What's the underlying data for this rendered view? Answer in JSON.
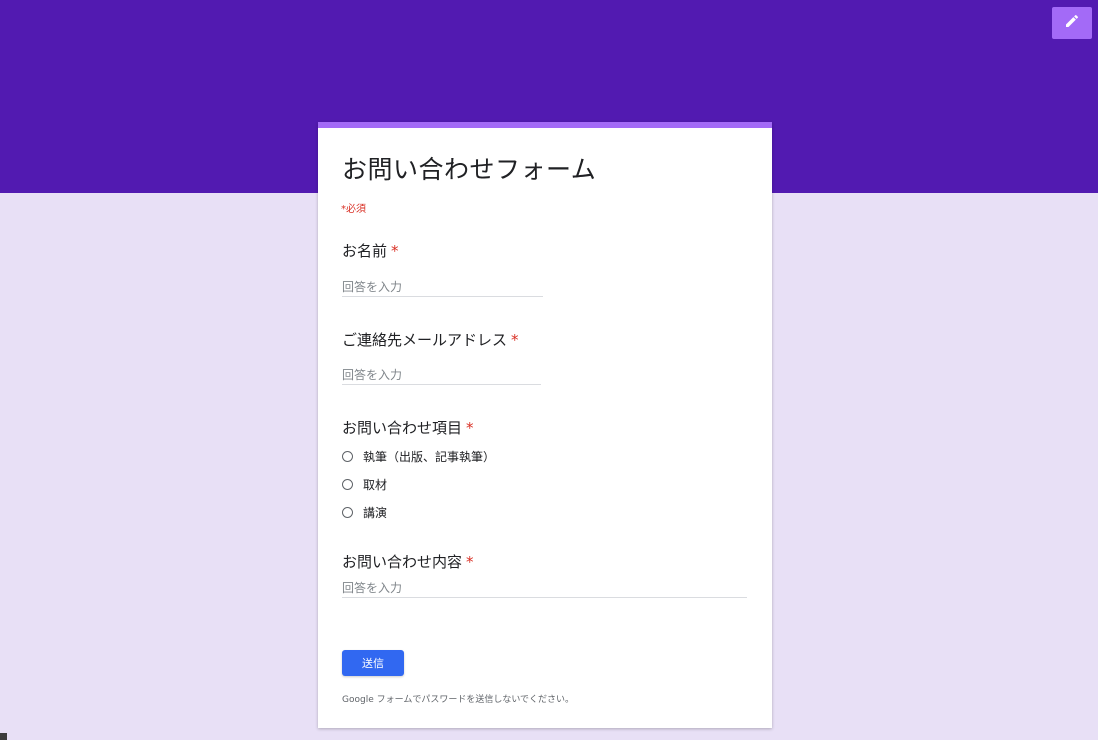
{
  "colors": {
    "header": "#521ab1",
    "background": "#e8e0f6",
    "accent": "#a36af7",
    "required": "#d93025",
    "submit": "#3168f1"
  },
  "toolbar": {
    "edit_icon": "pencil-icon"
  },
  "form": {
    "title": "お問い合わせフォーム",
    "required_note": "*必須",
    "questions": {
      "name": {
        "label": "お名前",
        "required_mark": "*",
        "placeholder": "回答を入力"
      },
      "email": {
        "label": "ご連絡先メールアドレス",
        "required_mark": "*",
        "placeholder": "回答を入力"
      },
      "category": {
        "label": "お問い合わせ項目",
        "required_mark": "*",
        "options": [
          "執筆（出版、記事執筆）",
          "取材",
          "講演"
        ],
        "selected": null
      },
      "message": {
        "label": "お問い合わせ内容",
        "required_mark": "*",
        "placeholder": "回答を入力"
      }
    },
    "submit_label": "送信",
    "footer_note": "Google フォームでパスワードを送信しないでください。"
  }
}
